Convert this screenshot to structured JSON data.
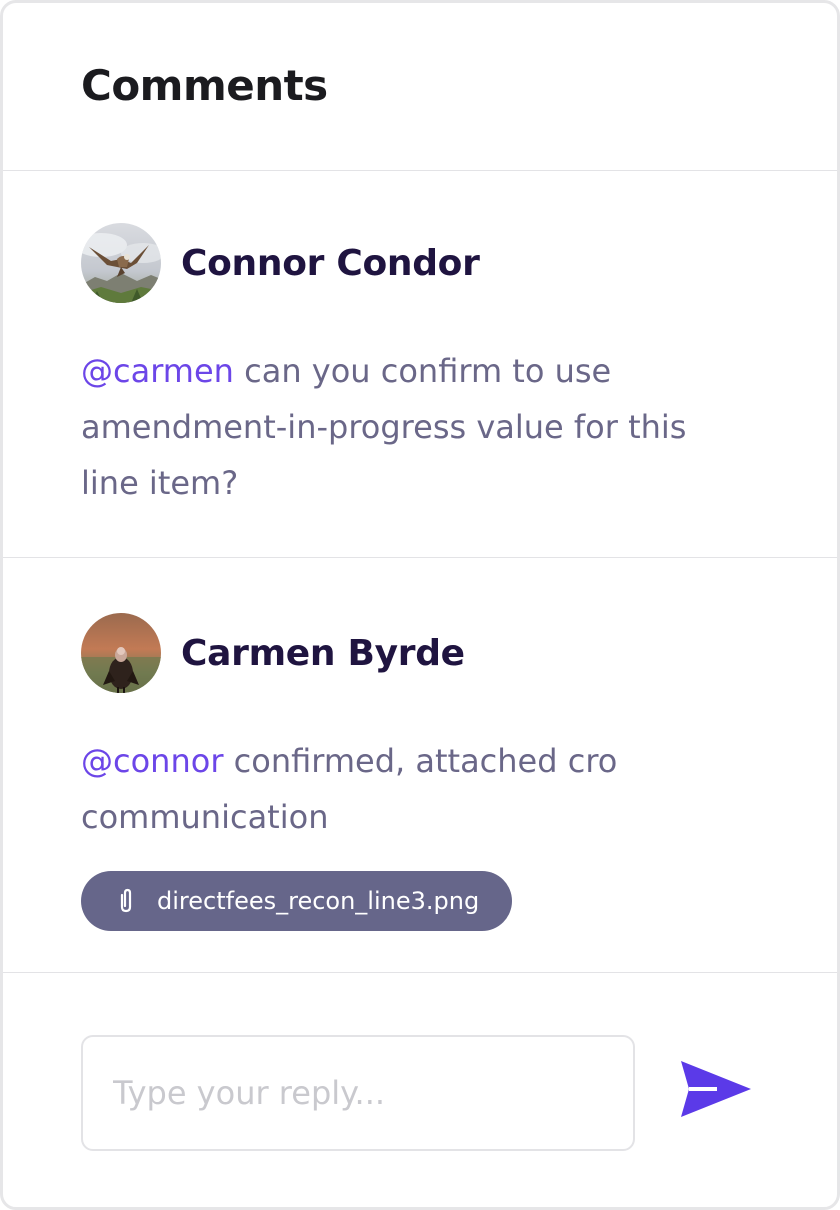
{
  "panel": {
    "title": "Comments"
  },
  "comments": [
    {
      "author": "Connor Condor",
      "avatar_icon": "condor-photo-avatar",
      "mention": "@carmen",
      "text": " can you confirm to use amendment-in-progress value for this line item?"
    },
    {
      "author": "Carmen Byrde",
      "avatar_icon": "vulture-photo-avatar",
      "mention": "@connor",
      "text": " confirmed, attached cro communication",
      "attachment": {
        "icon": "paperclip-icon",
        "filename": "directfees_recon_line3.png"
      }
    }
  ],
  "reply": {
    "placeholder": "Type your reply...",
    "value": "",
    "send_icon": "send-icon"
  },
  "colors": {
    "accent": "#6c46e8",
    "mention": "#6c46e8",
    "send": "#5b3ae8",
    "attachment_bg": "#66668a",
    "author": "#1f1440",
    "body_text": "#6a6788"
  }
}
